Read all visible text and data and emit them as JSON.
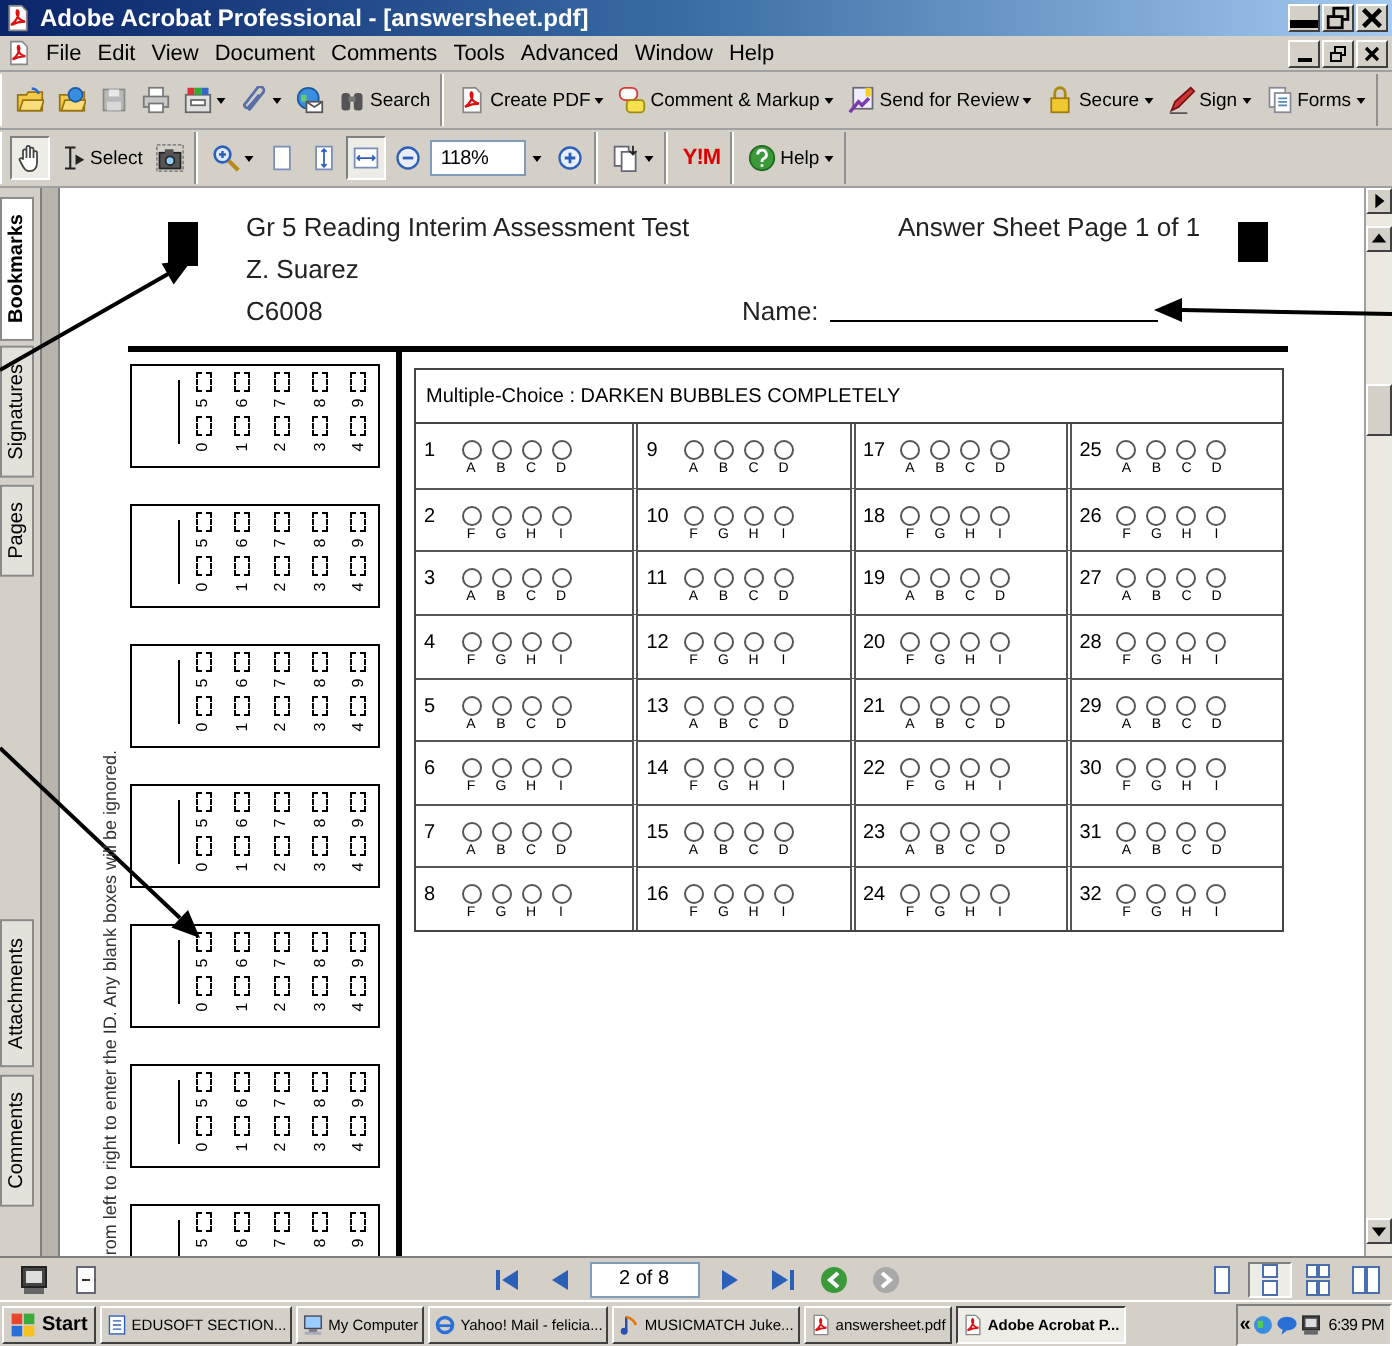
{
  "window": {
    "title": "Adobe Acrobat Professional - [answersheet.pdf]"
  },
  "menu": [
    "File",
    "Edit",
    "View",
    "Document",
    "Comments",
    "Tools",
    "Advanced",
    "Window",
    "Help"
  ],
  "toolbar_file": [
    {
      "dropdown": false
    },
    {
      "dropdown": false
    },
    {
      "dropdown": false
    },
    {
      "dropdown": false
    },
    {
      "dropdown": true
    },
    {
      "dropdown": true
    },
    {
      "dropdown": false
    },
    {
      "label": "Search",
      "dropdown": false
    }
  ],
  "toolbar_tasks": [
    {
      "label": "Create PDF",
      "dropdown": true
    },
    {
      "label": "Comment & Markup",
      "dropdown": true
    },
    {
      "label": "Send for Review",
      "dropdown": true
    },
    {
      "label": "Secure",
      "dropdown": true
    },
    {
      "label": "Sign",
      "dropdown": true
    },
    {
      "label": "Forms",
      "dropdown": true
    }
  ],
  "toolbar_view": {
    "groups": [
      [
        {
          "kind": "button",
          "selected": true,
          "dropdown": false
        },
        {
          "kind": "button",
          "label": "Select",
          "selected": false,
          "dropdown": false
        },
        {
          "kind": "button",
          "selected": false,
          "dropdown": false
        }
      ],
      [
        {
          "kind": "button",
          "selected": false,
          "dropdown": true
        },
        {
          "kind": "button",
          "selected": false,
          "dropdown": false
        },
        {
          "kind": "button",
          "selected": false,
          "dropdown": false
        },
        {
          "kind": "button",
          "selected": true,
          "dropdown": false
        },
        {
          "kind": "button",
          "selected": false,
          "dropdown": false
        },
        {
          "kind": "field",
          "value": "118%",
          "dropdown": true
        },
        {
          "kind": "button",
          "selected": false,
          "dropdown": false
        }
      ],
      [
        {
          "kind": "button",
          "selected": false,
          "dropdown": true
        }
      ],
      [
        {
          "kind": "logo",
          "label": "Y!M"
        }
      ],
      [
        {
          "kind": "button",
          "label": "Help",
          "selected": false,
          "dropdown": true
        }
      ]
    ]
  },
  "side_tabs_top": [
    {
      "label": "Bookmarks",
      "selected": true
    },
    {
      "label": "Signatures",
      "selected": false
    },
    {
      "label": "Pages",
      "selected": false
    }
  ],
  "side_tabs_bottom": [
    {
      "label": "Attachments",
      "selected": false
    },
    {
      "label": "Comments",
      "selected": false
    }
  ],
  "document": {
    "header": {
      "title": "Gr 5 Reading Interim Assessment Test",
      "student": "Z. Suarez",
      "code": "C6008",
      "page_label": "Answer Sheet Page 1 of 1",
      "name_label": "Name:"
    },
    "id_instruction": "rom left to right to enter the ID.  Any blank boxes will be ignored.",
    "id_boxes": [
      {
        "upper": [
          "5",
          "6",
          "7",
          "8",
          "9"
        ],
        "lower": [
          "0",
          "1",
          "2",
          "3",
          "4"
        ]
      },
      {
        "upper": [
          "5",
          "6",
          "7",
          "8",
          "9"
        ],
        "lower": [
          "0",
          "1",
          "2",
          "3",
          "4"
        ]
      },
      {
        "upper": [
          "5",
          "6",
          "7",
          "8",
          "9"
        ],
        "lower": [
          "0",
          "1",
          "2",
          "3",
          "4"
        ]
      },
      {
        "upper": [
          "5",
          "6",
          "7",
          "8",
          "9"
        ],
        "lower": [
          "0",
          "1",
          "2",
          "3",
          "4"
        ]
      },
      {
        "upper": [
          "5",
          "6",
          "7",
          "8",
          "9"
        ],
        "lower": [
          "0",
          "1",
          "2",
          "3",
          "4"
        ]
      },
      {
        "upper": [
          "5",
          "6",
          "7",
          "8",
          "9"
        ],
        "lower": [
          "0",
          "1",
          "2",
          "3",
          "4"
        ]
      },
      {
        "upper": [
          "5",
          "6",
          "7",
          "8",
          "9"
        ]
      }
    ],
    "multiple_choice": {
      "title": "Multiple-Choice : DARKEN BUBBLES COMPLETELY",
      "questions": [
        {
          "number": "1",
          "choices": [
            "A",
            "B",
            "C",
            "D"
          ]
        },
        {
          "number": "2",
          "choices": [
            "F",
            "G",
            "H",
            "I"
          ]
        },
        {
          "number": "3",
          "choices": [
            "A",
            "B",
            "C",
            "D"
          ]
        },
        {
          "number": "4",
          "choices": [
            "F",
            "G",
            "H",
            "I"
          ]
        },
        {
          "number": "5",
          "choices": [
            "A",
            "B",
            "C",
            "D"
          ]
        },
        {
          "number": "6",
          "choices": [
            "F",
            "G",
            "H",
            "I"
          ]
        },
        {
          "number": "7",
          "choices": [
            "A",
            "B",
            "C",
            "D"
          ]
        },
        {
          "number": "8",
          "choices": [
            "F",
            "G",
            "H",
            "I"
          ]
        },
        {
          "number": "9",
          "choices": [
            "A",
            "B",
            "C",
            "D"
          ]
        },
        {
          "number": "10",
          "choices": [
            "F",
            "G",
            "H",
            "I"
          ]
        },
        {
          "number": "11",
          "choices": [
            "A",
            "B",
            "C",
            "D"
          ]
        },
        {
          "number": "12",
          "choices": [
            "F",
            "G",
            "H",
            "I"
          ]
        },
        {
          "number": "13",
          "choices": [
            "A",
            "B",
            "C",
            "D"
          ]
        },
        {
          "number": "14",
          "choices": [
            "F",
            "G",
            "H",
            "I"
          ]
        },
        {
          "number": "15",
          "choices": [
            "A",
            "B",
            "C",
            "D"
          ]
        },
        {
          "number": "16",
          "choices": [
            "F",
            "G",
            "H",
            "I"
          ]
        },
        {
          "number": "17",
          "choices": [
            "A",
            "B",
            "C",
            "D"
          ]
        },
        {
          "number": "18",
          "choices": [
            "F",
            "G",
            "H",
            "I"
          ]
        },
        {
          "number": "19",
          "choices": [
            "A",
            "B",
            "C",
            "D"
          ]
        },
        {
          "number": "20",
          "choices": [
            "F",
            "G",
            "H",
            "I"
          ]
        },
        {
          "number": "21",
          "choices": [
            "A",
            "B",
            "C",
            "D"
          ]
        },
        {
          "number": "22",
          "choices": [
            "F",
            "G",
            "H",
            "I"
          ]
        },
        {
          "number": "23",
          "choices": [
            "A",
            "B",
            "C",
            "D"
          ]
        },
        {
          "number": "24",
          "choices": [
            "F",
            "G",
            "H",
            "I"
          ]
        },
        {
          "number": "25",
          "choices": [
            "A",
            "B",
            "C",
            "D"
          ]
        },
        {
          "number": "26",
          "choices": [
            "F",
            "G",
            "H",
            "I"
          ]
        },
        {
          "number": "27",
          "choices": [
            "A",
            "B",
            "C",
            "D"
          ]
        },
        {
          "number": "28",
          "choices": [
            "F",
            "G",
            "H",
            "I"
          ]
        },
        {
          "number": "29",
          "choices": [
            "A",
            "B",
            "C",
            "D"
          ]
        },
        {
          "number": "30",
          "choices": [
            "F",
            "G",
            "H",
            "I"
          ]
        },
        {
          "number": "31",
          "choices": [
            "A",
            "B",
            "C",
            "D"
          ]
        },
        {
          "number": "32",
          "choices": [
            "F",
            "G",
            "H",
            "I"
          ]
        }
      ]
    }
  },
  "page_nav": {
    "page_field": "2 of 8",
    "view_modes": [
      {
        "selected": false
      },
      {
        "selected": true
      },
      {
        "selected": false
      },
      {
        "selected": false
      }
    ]
  },
  "taskbar": {
    "start": "Start",
    "tasks": [
      {
        "label": "EDUSOFT SECTION...",
        "selected": false
      },
      {
        "label": "My Computer",
        "selected": false
      },
      {
        "label": "Yahoo! Mail - felicia...",
        "selected": false
      },
      {
        "label": "MUSICMATCH Juke...",
        "selected": false
      },
      {
        "label": "answersheet.pdf",
        "selected": false
      },
      {
        "label": "Adobe Acrobat P...",
        "selected": true
      }
    ],
    "chevron": "«",
    "clock": "6:39 PM"
  }
}
